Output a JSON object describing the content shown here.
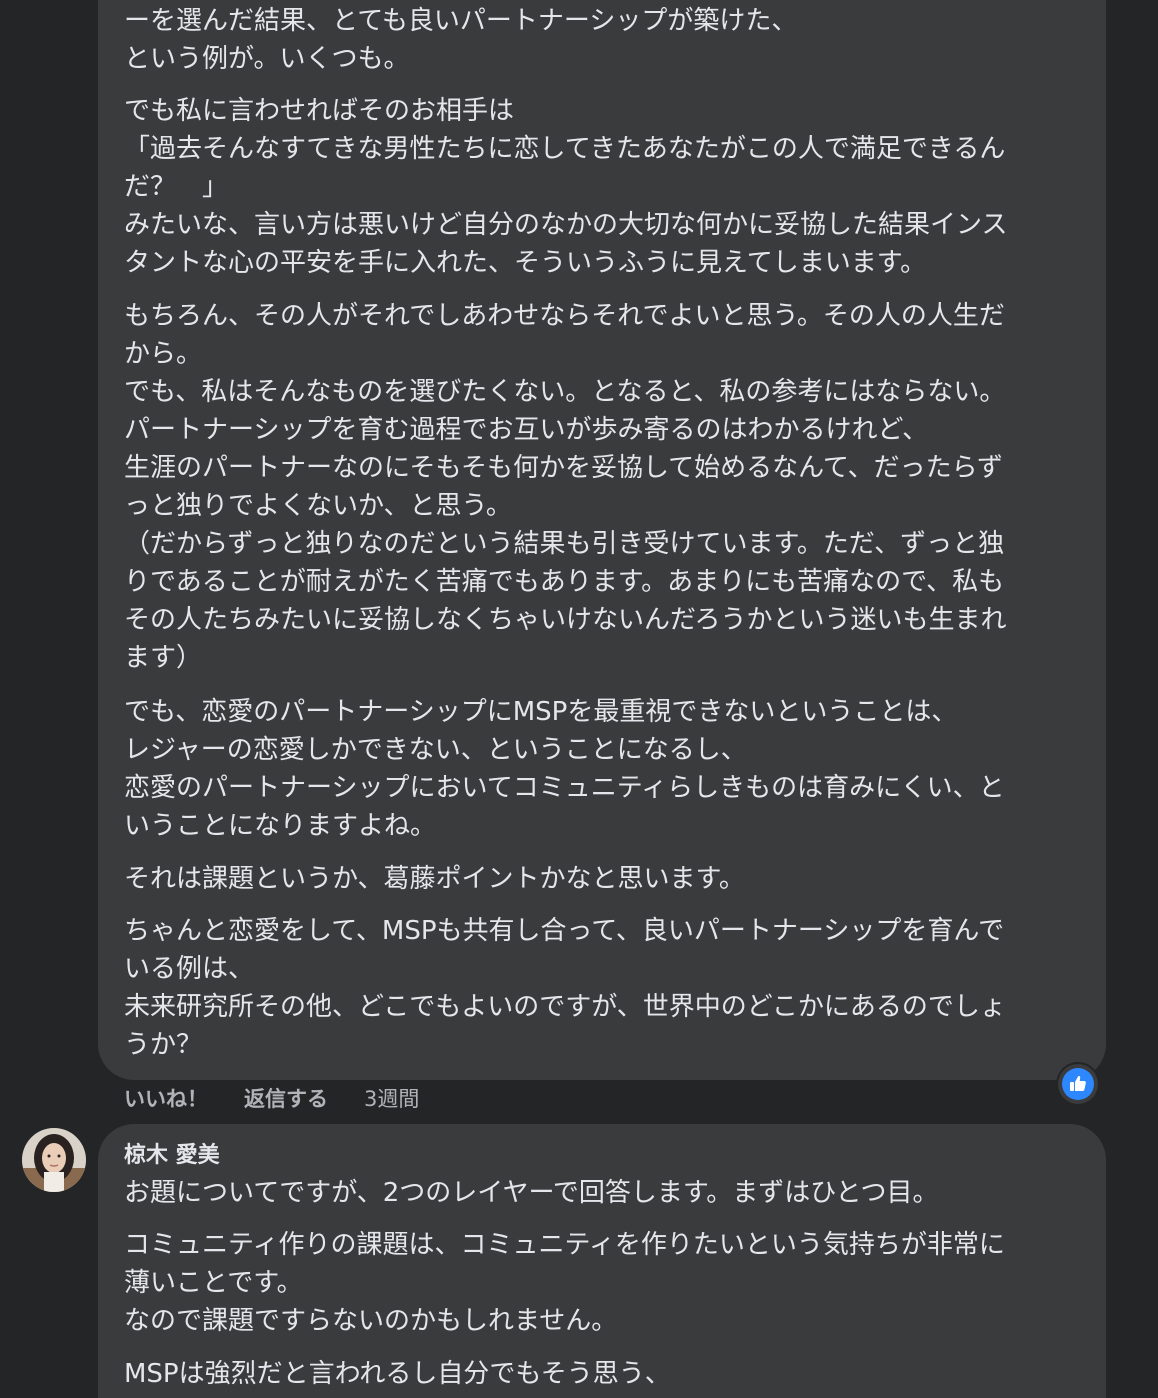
{
  "comment1": {
    "paragraphs": [
      "ーを選んだ結果、とても良いパートナーシップが築けた、\nという例が。いくつも。",
      "でも私に言わせればそのお相手は\n「過去そんなすてきな男性たちに恋してきたあなたがこの人で満足できるん\nだ？　」\nみたいな、言い方は悪いけど自分のなかの大切な何かに妥協した結果インス\nタントな心の平安を手に入れた、そういうふうに見えてしまいます。",
      "もちろん、その人がそれでしあわせならそれでよいと思う。その人の人生だ\nから。\nでも、私はそんなものを選びたくない。となると、私の参考にはならない。\nパートナーシップを育む過程でお互いが歩み寄るのはわかるけれど、\n生涯のパートナーなのにそもそも何かを妥協して始めるなんて、だったらず\nっと独りでよくないか、と思う。\n（だからずっと独りなのだという結果も引き受けています。ただ、ずっと独\nりであることが耐えがたく苦痛でもあります。あまりにも苦痛なので、私も\nその人たちみたいに妥協しなくちゃいけないんだろうかという迷いも生まれ\nます）",
      "でも、恋愛のパートナーシップにMSPを最重視できないということは、\nレジャーの恋愛しかできない、ということになるし、\n恋愛のパートナーシップにおいてコミュニティらしきものは育みにくい、と\nいうことになりますよね。",
      "それは課題というか、葛藤ポイントかなと思います。",
      "ちゃんと恋愛をして、MSPも共有し合って、良いパートナーシップを育んで\nいる例は、\n未来研究所その他、どこでもよいのですが、世界中のどこかにあるのでしょ\nうか？"
    ],
    "actions": {
      "like": "いいね！",
      "reply": "返信する",
      "time": "3週間"
    },
    "reaction_icon": "thumbs-up-icon",
    "reaction_color": "#2d88ff"
  },
  "comment2": {
    "author": "椋木 愛美",
    "paragraphs": [
      "お題についてですが、2つのレイヤーで回答します。まずはひとつ目。",
      "コミュニティ作りの課題は、コミュニティを作りたいという気持ちが非常に\n薄いことです。\nなので課題ですらないのかもしれません。",
      "MSPは強烈だと言われるし自分でもそう思う、"
    ]
  }
}
